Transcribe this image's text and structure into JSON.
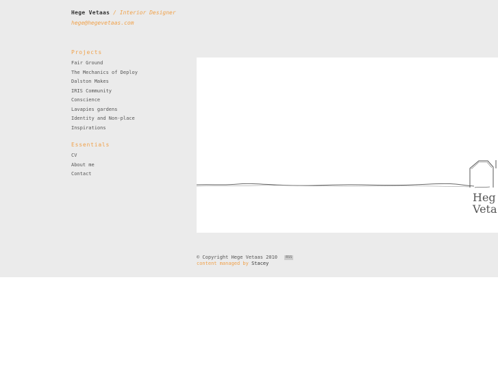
{
  "header": {
    "name": "Hege Vetaas",
    "separator": "/",
    "role": "Interior Designer",
    "email": "hege@hegevetaas.com"
  },
  "nav": {
    "projects": {
      "heading": "Projects",
      "items": [
        "Fair Ground",
        "The Mechanics of Deploy",
        "Dalston Makes",
        "IRIS Community",
        "Conscience",
        "Lavapies gardens",
        "Identity and Non-place",
        "Inspirations"
      ]
    },
    "essentials": {
      "heading": "Essentials",
      "items": [
        "CV",
        "About me",
        "Contact"
      ]
    }
  },
  "image": {
    "logo_text_line1": "Heg",
    "logo_text_line2": "Veta"
  },
  "footer": {
    "copyright": "© Copyright Hege Vetaas 2010",
    "rss": "RSS",
    "credit_prefix": "content managed by",
    "credit_link": "Stacey"
  },
  "colors": {
    "accent": "#f0a14a",
    "background": "#ebebeb",
    "text": "#555555"
  }
}
